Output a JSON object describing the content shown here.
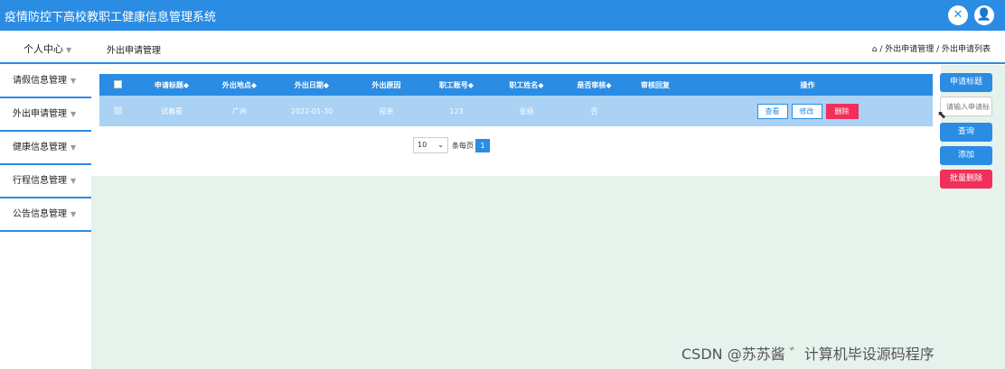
{
  "header": {
    "title": "疫情防控下高校教职工健康信息管理系统",
    "icon_close": "✕",
    "icon_user": "👤"
  },
  "topnav": {
    "personal": "个人中心",
    "current_module": "外出申请管理",
    "breadcrumb": "⌂ / 外出申请管理 / 外出申请列表"
  },
  "sidebar": {
    "items": [
      {
        "label": "请假信息管理"
      },
      {
        "label": "外出申请管理"
      },
      {
        "label": "健康信息管理"
      },
      {
        "label": "行程信息管理"
      },
      {
        "label": "公告信息管理"
      }
    ]
  },
  "table": {
    "headers": [
      "申请标题◆",
      "外出地点◆",
      "外出日期◆",
      "外出原因",
      "职工账号◆",
      "职工姓名◆",
      "是否审核◆",
      "审核回复",
      "操作"
    ],
    "rows": [
      {
        "title": "试着看",
        "place": "广州",
        "date": "2022-01-30",
        "reason": "探亲",
        "account": "123",
        "name": "张扬",
        "audited": "否",
        "reply": "",
        "actions": {
          "view": "查看",
          "edit": "修改",
          "delete": "删除"
        }
      }
    ]
  },
  "pager": {
    "page_size": "10",
    "per_page_label": "条每页",
    "current_page": "1"
  },
  "right_panel": {
    "title_button": "申请标题",
    "search_placeholder": "请输入申请标",
    "search_button": "查询",
    "add_button": "添加",
    "batch_delete_button": "批量删除"
  },
  "watermark": "CSDN @苏苏酱 ゛计算机毕设源码程序",
  "colors": {
    "primary": "#2b8ce3",
    "danger": "#f0305a",
    "row_selected": "#a9d2f5",
    "content_bg": "#e6f2ec"
  }
}
